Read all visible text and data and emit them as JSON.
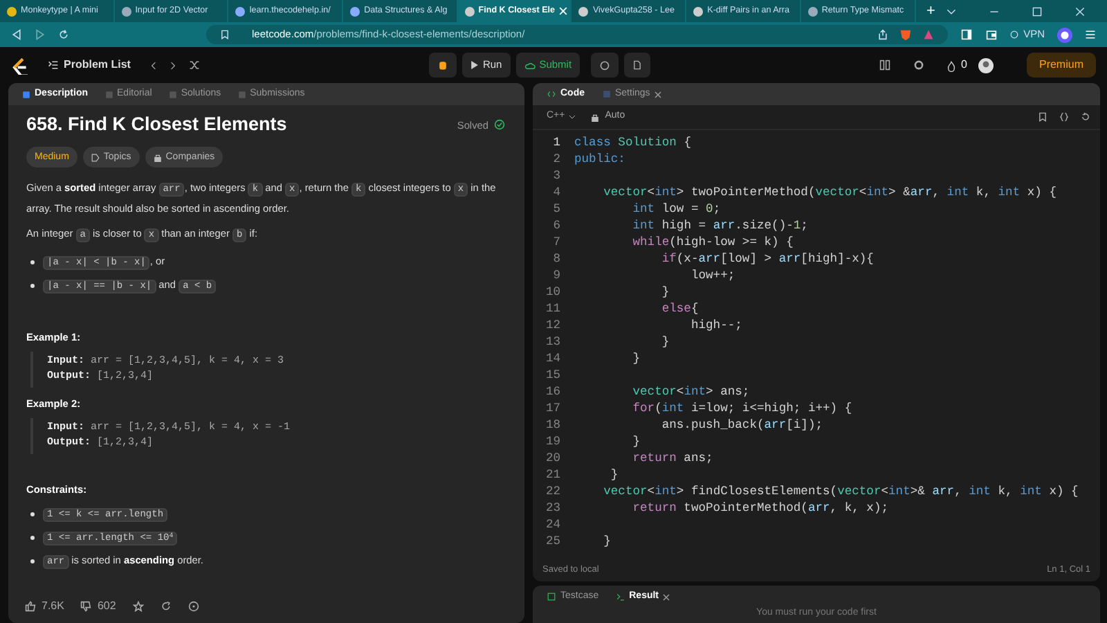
{
  "browser": {
    "tabs": [
      {
        "title": "Monkeytype | A mini",
        "selected": false
      },
      {
        "title": "Input for 2D Vector",
        "selected": false
      },
      {
        "title": "learn.thecodehelp.in/",
        "selected": false
      },
      {
        "title": "Data Structures & Alg",
        "selected": false
      },
      {
        "title": "Find K Closest Ele",
        "selected": true
      },
      {
        "title": "VivekGupta258 - Lee",
        "selected": false
      },
      {
        "title": "K-diff Pairs in an Arra",
        "selected": false
      },
      {
        "title": "Return Type Mismatc",
        "selected": false
      }
    ],
    "new_tab": "+",
    "url_host": "leetcode.com",
    "url_path": "/problems/find-k-closest-elements/description/",
    "vpn": "VPN"
  },
  "nav": {
    "problem_list": "Problem List",
    "run": "Run",
    "submit": "Submit",
    "streak": "0",
    "premium": "Premium"
  },
  "description": {
    "tabs": [
      {
        "label": "Description",
        "selected": true
      },
      {
        "label": "Editorial",
        "selected": false
      },
      {
        "label": "Solutions",
        "selected": false
      },
      {
        "label": "Submissions",
        "selected": false
      }
    ],
    "title": "658. Find K Closest Elements",
    "status": "Solved",
    "tags": [
      {
        "label": "Medium",
        "kind": "difficulty"
      },
      {
        "label": "Topics",
        "kind": "topics"
      },
      {
        "label": "Companies",
        "kind": "companies"
      }
    ],
    "paragraphs": [
      [
        {
          "kind": "text",
          "text": "Given a "
        },
        {
          "kind": "bold",
          "text": "sorted"
        },
        {
          "kind": "text",
          "text": " integer array "
        },
        {
          "kind": "code",
          "text": "arr"
        },
        {
          "kind": "text",
          "text": ", two integers "
        },
        {
          "kind": "code",
          "text": "k"
        },
        {
          "kind": "text",
          "text": " and "
        },
        {
          "kind": "code",
          "text": "x"
        },
        {
          "kind": "text",
          "text": ", return the "
        },
        {
          "kind": "code",
          "text": "k"
        },
        {
          "kind": "text",
          "text": " closest integers to "
        },
        {
          "kind": "code",
          "text": "x"
        },
        {
          "kind": "text",
          "text": " in the array. The result should also be sorted in ascending order."
        }
      ],
      [
        {
          "kind": "text",
          "text": "An integer "
        },
        {
          "kind": "code",
          "text": "a"
        },
        {
          "kind": "text",
          "text": " is closer to "
        },
        {
          "kind": "code",
          "text": "x"
        },
        {
          "kind": "text",
          "text": " than an integer "
        },
        {
          "kind": "code",
          "text": "b"
        },
        {
          "kind": "text",
          "text": " if:"
        }
      ]
    ],
    "bullets": [
      [
        {
          "kind": "code",
          "text": "|a - x| < |b - x|"
        },
        {
          "kind": "text",
          "text": ", or"
        }
      ],
      [
        {
          "kind": "code",
          "text": "|a - x| == |b - x|"
        },
        {
          "kind": "text",
          "text": " and "
        },
        {
          "kind": "code",
          "text": "a < b"
        }
      ]
    ],
    "examples": [
      {
        "heading": "Example 1:",
        "input_label": "Input:",
        "input": "arr = [1,2,3,4,5], k = 4, x = 3",
        "output_label": "Output:",
        "output": "[1,2,3,4]"
      },
      {
        "heading": "Example 2:",
        "input_label": "Input:",
        "input": "arr = [1,2,3,4,5], k = 4, x = -1",
        "output_label": "Output:",
        "output": "[1,2,3,4]"
      }
    ],
    "constraints_heading": "Constraints:",
    "constraints": [
      [
        {
          "kind": "code",
          "text": "1 <= k <= arr.length"
        }
      ],
      [
        {
          "kind": "code",
          "text": "1 <= arr.length <= 10$^{4}$"
        }
      ],
      [
        {
          "kind": "code",
          "text": "arr"
        },
        {
          "kind": "text",
          "text": " is sorted in "
        },
        {
          "kind": "bold",
          "text": "ascending"
        },
        {
          "kind": "text",
          "text": " order."
        }
      ]
    ],
    "likes": "7.6K",
    "dislikes": "602"
  },
  "editor": {
    "tabs": [
      {
        "label": "Code",
        "selected": true
      },
      {
        "label": "Settings",
        "selected": false
      }
    ],
    "language": "C++",
    "mode": "Auto",
    "lines": [
      {
        "number": "1",
        "tokens": [
          {
            "kind": "keyword",
            "text": "class"
          },
          {
            "kind": "type",
            "text": " Solution"
          },
          {
            "kind": "plain",
            "text": " {"
          }
        ]
      },
      {
        "number": "2",
        "tokens": [
          {
            "kind": "keyword",
            "text": "public:"
          }
        ]
      },
      {
        "number": "3"
      },
      {
        "number": "4",
        "tokens": [
          {
            "kind": "type",
            "text": "    vector"
          },
          {
            "kind": "plain",
            "text": "<"
          },
          {
            "kind": "keyword",
            "text": "int"
          },
          {
            "kind": "plain",
            "text": "> twoPointerMethod("
          },
          {
            "kind": "type",
            "text": "vector"
          },
          {
            "kind": "plain",
            "text": "<"
          },
          {
            "kind": "keyword",
            "text": "int"
          },
          {
            "kind": "plain",
            "text": "> &"
          },
          {
            "kind": "variable",
            "text": "arr"
          },
          {
            "kind": "plain",
            "text": ", "
          },
          {
            "kind": "keyword",
            "text": "int"
          },
          {
            "kind": "plain",
            "text": " k, "
          },
          {
            "kind": "keyword",
            "text": "int"
          },
          {
            "kind": "plain",
            "text": " x) {"
          }
        ]
      },
      {
        "number": "5",
        "tokens": [
          {
            "kind": "keyword",
            "text": "        int"
          },
          {
            "kind": "plain",
            "text": " low = "
          },
          {
            "kind": "number",
            "text": "0"
          },
          {
            "kind": "plain",
            "text": ";"
          }
        ]
      },
      {
        "number": "6",
        "tokens": [
          {
            "kind": "keyword",
            "text": "        int"
          },
          {
            "kind": "plain",
            "text": " high = "
          },
          {
            "kind": "variable",
            "text": "arr"
          },
          {
            "kind": "plain",
            "text": ".size()-"
          },
          {
            "kind": "number",
            "text": "1"
          },
          {
            "kind": "plain",
            "text": ";"
          }
        ]
      },
      {
        "number": "7",
        "tokens": [
          {
            "kind": "control",
            "text": "        while"
          },
          {
            "kind": "plain",
            "text": "(high-low >= k) {"
          }
        ]
      },
      {
        "number": "8",
        "tokens": [
          {
            "kind": "control",
            "text": "            if"
          },
          {
            "kind": "plain",
            "text": "(x-"
          },
          {
            "kind": "variable",
            "text": "arr"
          },
          {
            "kind": "plain",
            "text": "[low] > "
          },
          {
            "kind": "variable",
            "text": "arr"
          },
          {
            "kind": "plain",
            "text": "[high]-x){"
          }
        ]
      },
      {
        "number": "9",
        "tokens": [
          {
            "kind": "plain",
            "text": "                low++;"
          }
        ]
      },
      {
        "number": "10",
        "tokens": [
          {
            "kind": "plain",
            "text": "            }"
          }
        ]
      },
      {
        "number": "11",
        "tokens": [
          {
            "kind": "control",
            "text": "            else"
          },
          {
            "kind": "plain",
            "text": "{"
          }
        ]
      },
      {
        "number": "12",
        "tokens": [
          {
            "kind": "plain",
            "text": "                high--;"
          }
        ]
      },
      {
        "number": "13",
        "tokens": [
          {
            "kind": "plain",
            "text": "            }"
          }
        ]
      },
      {
        "number": "14",
        "tokens": [
          {
            "kind": "plain",
            "text": "        }"
          }
        ]
      },
      {
        "number": "15"
      },
      {
        "number": "16",
        "tokens": [
          {
            "kind": "type",
            "text": "        vector"
          },
          {
            "kind": "plain",
            "text": "<"
          },
          {
            "kind": "keyword",
            "text": "int"
          },
          {
            "kind": "plain",
            "text": "> ans;"
          }
        ]
      },
      {
        "number": "17",
        "tokens": [
          {
            "kind": "control",
            "text": "        for"
          },
          {
            "kind": "plain",
            "text": "("
          },
          {
            "kind": "keyword",
            "text": "int"
          },
          {
            "kind": "plain",
            "text": " i=low; i<=high; i++) {"
          }
        ]
      },
      {
        "number": "18",
        "tokens": [
          {
            "kind": "plain",
            "text": "            ans.push_back("
          },
          {
            "kind": "variable",
            "text": "arr"
          },
          {
            "kind": "plain",
            "text": "[i]);"
          }
        ]
      },
      {
        "number": "19",
        "tokens": [
          {
            "kind": "plain",
            "text": "        }"
          }
        ]
      },
      {
        "number": "20",
        "tokens": [
          {
            "kind": "control",
            "text": "        return"
          },
          {
            "kind": "plain",
            "text": " ans;"
          }
        ]
      },
      {
        "number": "21",
        "tokens": [
          {
            "kind": "plain",
            "text": "     }"
          }
        ]
      },
      {
        "number": "22",
        "tokens": [
          {
            "kind": "type",
            "text": "    vector"
          },
          {
            "kind": "plain",
            "text": "<"
          },
          {
            "kind": "keyword",
            "text": "int"
          },
          {
            "kind": "plain",
            "text": "> findClosestElements("
          },
          {
            "kind": "type",
            "text": "vector"
          },
          {
            "kind": "plain",
            "text": "<"
          },
          {
            "kind": "keyword",
            "text": "int"
          },
          {
            "kind": "plain",
            "text": ">& "
          },
          {
            "kind": "variable",
            "text": "arr"
          },
          {
            "kind": "plain",
            "text": ", "
          },
          {
            "kind": "keyword",
            "text": "int"
          },
          {
            "kind": "plain",
            "text": " k, "
          },
          {
            "kind": "keyword",
            "text": "int"
          },
          {
            "kind": "plain",
            "text": " x) {"
          }
        ]
      },
      {
        "number": "23",
        "tokens": [
          {
            "kind": "control",
            "text": "        return"
          },
          {
            "kind": "plain",
            "text": " twoPointerMethod("
          },
          {
            "kind": "variable",
            "text": "arr"
          },
          {
            "kind": "plain",
            "text": ", k, x);"
          }
        ]
      },
      {
        "number": "24"
      },
      {
        "number": "25",
        "tokens": [
          {
            "kind": "plain",
            "text": "    }"
          }
        ]
      }
    ],
    "saved": "Saved to local",
    "cursor": "Ln 1, Col 1"
  },
  "console": {
    "tabs": [
      {
        "label": "Testcase",
        "selected": false
      },
      {
        "label": "Result",
        "selected": true
      }
    ],
    "message": "You must run your code first"
  }
}
